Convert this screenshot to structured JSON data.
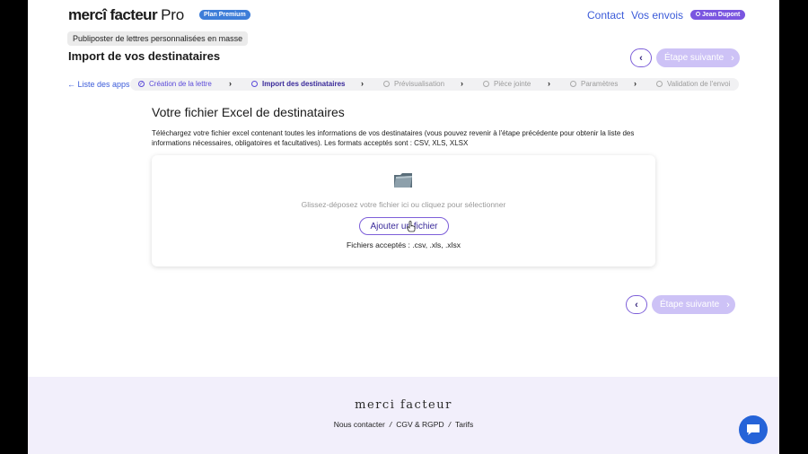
{
  "header": {
    "logo_main": "mercî facteur",
    "logo_suffix": "Pro",
    "plan_badge": "Plan Premium",
    "nav_contact": "Contact",
    "nav_orders": "Vos envois",
    "user_name": "Jean Dupont"
  },
  "page": {
    "breadcrumb": "Publiposter de lettres personnalisées en masse",
    "title": "Import de vos destinataires",
    "next_label": "Étape suivante"
  },
  "stepper": {
    "back_label": "Liste des apps",
    "steps": [
      {
        "label": "Création de la lettre",
        "state": "done"
      },
      {
        "label": "Import des destinataires",
        "state": "active"
      },
      {
        "label": "Prévisualisation",
        "state": "pending"
      },
      {
        "label": "Pièce jointe",
        "state": "pending"
      },
      {
        "label": "Paramètres",
        "state": "pending"
      },
      {
        "label": "Validation de l'envoi",
        "state": "pending"
      }
    ]
  },
  "main": {
    "section_title": "Votre fichier Excel de destinataires",
    "description": "Téléchargez votre fichier excel contenant toutes les informations de vos destinataires (vous pouvez revenir à l'étape précédente pour obtenir la liste des informations nécessaires, obligatoires et facultatives). Les formats acceptés sont : CSV, XLS, XLSX",
    "dropzone_text": "Glissez-déposez votre fichier ici ou cliquez pour sélectionner",
    "add_button": "Ajouter un fichier",
    "accepted_formats": "Fichiers acceptés : .csv, .xls, .xlsx"
  },
  "footer": {
    "logo": "merci facteur",
    "links": [
      "Nous contacter",
      "CGV & RGPD",
      "Tarifs"
    ]
  },
  "colors": {
    "accent": "#7d5fd9",
    "link": "#3b5bd9",
    "chat": "#2563d8"
  }
}
